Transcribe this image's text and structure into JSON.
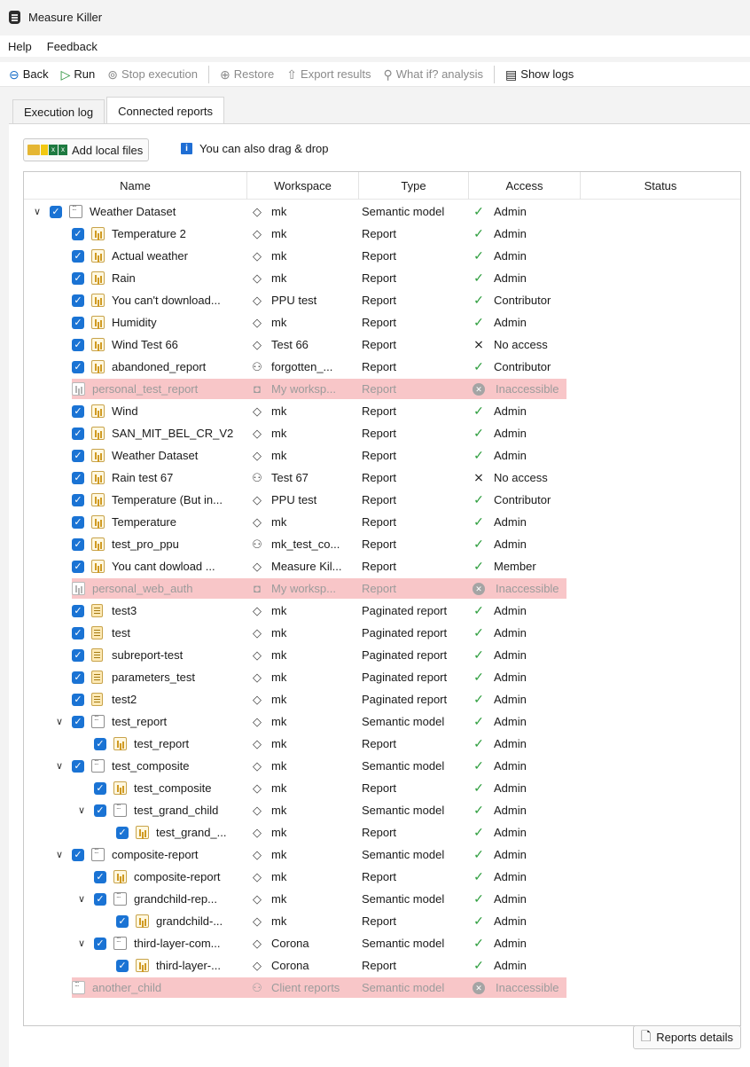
{
  "window": {
    "title": "Measure Killer"
  },
  "menu": {
    "help": "Help",
    "feedback": "Feedback"
  },
  "toolbar": {
    "back": "Back",
    "run": "Run",
    "stop": "Stop execution",
    "restore": "Restore",
    "export": "Export results",
    "whatif": "What if? analysis",
    "logs": "Show logs"
  },
  "tabs": [
    "Execution log",
    "Connected reports"
  ],
  "add_files": {
    "label": "Add local files",
    "hint": "You can also drag & drop"
  },
  "columns": {
    "name": "Name",
    "workspace": "Workspace",
    "type": "Type",
    "access": "Access",
    "status": "Status"
  },
  "rows": [
    {
      "name": "Weather Dataset",
      "ws": "mk",
      "type": "Semantic model",
      "access": "Admin"
    },
    {
      "name": "Temperature 2",
      "ws": "mk",
      "type": "Report",
      "access": "Admin"
    },
    {
      "name": "Actual weather",
      "ws": "mk",
      "type": "Report",
      "access": "Admin"
    },
    {
      "name": "Rain",
      "ws": "mk",
      "type": "Report",
      "access": "Admin"
    },
    {
      "name": "You can't download...",
      "ws": "PPU test",
      "type": "Report",
      "access": "Contributor"
    },
    {
      "name": "Humidity",
      "ws": "mk",
      "type": "Report",
      "access": "Admin"
    },
    {
      "name": "Wind Test 66",
      "ws": "Test 66",
      "type": "Report",
      "access": "No access"
    },
    {
      "name": "abandoned_report",
      "ws": "forgotten_...",
      "type": "Report",
      "access": "Contributor"
    },
    {
      "name": "personal_test_report",
      "ws": "My worksp...",
      "type": "Report",
      "access": "Inaccessible"
    },
    {
      "name": "Wind",
      "ws": "mk",
      "type": "Report",
      "access": "Admin"
    },
    {
      "name": "SAN_MIT_BEL_CR_V2",
      "ws": "mk",
      "type": "Report",
      "access": "Admin"
    },
    {
      "name": "Weather Dataset",
      "ws": "mk",
      "type": "Report",
      "access": "Admin"
    },
    {
      "name": "Rain test 67",
      "ws": "Test 67",
      "type": "Report",
      "access": "No access"
    },
    {
      "name": "Temperature (But in...",
      "ws": "PPU test",
      "type": "Report",
      "access": "Contributor"
    },
    {
      "name": "Temperature",
      "ws": "mk",
      "type": "Report",
      "access": "Admin"
    },
    {
      "name": "test_pro_ppu",
      "ws": "mk_test_co...",
      "type": "Report",
      "access": "Admin"
    },
    {
      "name": "You cant dowload ...",
      "ws": "Measure Kil...",
      "type": "Report",
      "access": "Member"
    },
    {
      "name": "personal_web_auth",
      "ws": "My worksp...",
      "type": "Report",
      "access": "Inaccessible"
    },
    {
      "name": "test3",
      "ws": "mk",
      "type": "Paginated report",
      "access": "Admin"
    },
    {
      "name": "test",
      "ws": "mk",
      "type": "Paginated report",
      "access": "Admin"
    },
    {
      "name": "subreport-test",
      "ws": "mk",
      "type": "Paginated report",
      "access": "Admin"
    },
    {
      "name": "parameters_test",
      "ws": "mk",
      "type": "Paginated report",
      "access": "Admin"
    },
    {
      "name": "test2",
      "ws": "mk",
      "type": "Paginated report",
      "access": "Admin"
    },
    {
      "name": "test_report",
      "ws": "mk",
      "type": "Semantic model",
      "access": "Admin"
    },
    {
      "name": "test_report",
      "ws": "mk",
      "type": "Report",
      "access": "Admin"
    },
    {
      "name": "test_composite",
      "ws": "mk",
      "type": "Semantic model",
      "access": "Admin"
    },
    {
      "name": "test_composite",
      "ws": "mk",
      "type": "Report",
      "access": "Admin"
    },
    {
      "name": "test_grand_child",
      "ws": "mk",
      "type": "Semantic model",
      "access": "Admin"
    },
    {
      "name": "test_grand_...",
      "ws": "mk",
      "type": "Report",
      "access": "Admin"
    },
    {
      "name": "composite-report",
      "ws": "mk",
      "type": "Semantic model",
      "access": "Admin"
    },
    {
      "name": "composite-report",
      "ws": "mk",
      "type": "Report",
      "access": "Admin"
    },
    {
      "name": "grandchild-rep...",
      "ws": "mk",
      "type": "Semantic model",
      "access": "Admin"
    },
    {
      "name": "grandchild-...",
      "ws": "mk",
      "type": "Report",
      "access": "Admin"
    },
    {
      "name": "third-layer-com...",
      "ws": "Corona",
      "type": "Semantic model",
      "access": "Admin"
    },
    {
      "name": "third-layer-...",
      "ws": "Corona",
      "type": "Report",
      "access": "Admin"
    },
    {
      "name": "another_child",
      "ws": "Client reports",
      "type": "Semantic model",
      "access": "Inaccessible"
    }
  ],
  "details_button": "Reports details",
  "colors": {
    "accent": "#1a73d4",
    "inaccessible_bg": "#f8c6c8",
    "access_ok": "#2e9e3e"
  }
}
